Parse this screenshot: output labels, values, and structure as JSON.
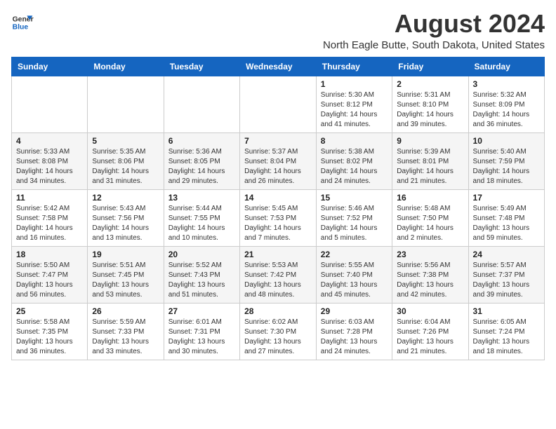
{
  "logo": {
    "line1": "General",
    "line2": "Blue"
  },
  "title": "August 2024",
  "location": "North Eagle Butte, South Dakota, United States",
  "weekdays": [
    "Sunday",
    "Monday",
    "Tuesday",
    "Wednesday",
    "Thursday",
    "Friday",
    "Saturday"
  ],
  "weeks": [
    [
      {
        "day": "",
        "info": ""
      },
      {
        "day": "",
        "info": ""
      },
      {
        "day": "",
        "info": ""
      },
      {
        "day": "",
        "info": ""
      },
      {
        "day": "1",
        "info": "Sunrise: 5:30 AM\nSunset: 8:12 PM\nDaylight: 14 hours\nand 41 minutes."
      },
      {
        "day": "2",
        "info": "Sunrise: 5:31 AM\nSunset: 8:10 PM\nDaylight: 14 hours\nand 39 minutes."
      },
      {
        "day": "3",
        "info": "Sunrise: 5:32 AM\nSunset: 8:09 PM\nDaylight: 14 hours\nand 36 minutes."
      }
    ],
    [
      {
        "day": "4",
        "info": "Sunrise: 5:33 AM\nSunset: 8:08 PM\nDaylight: 14 hours\nand 34 minutes."
      },
      {
        "day": "5",
        "info": "Sunrise: 5:35 AM\nSunset: 8:06 PM\nDaylight: 14 hours\nand 31 minutes."
      },
      {
        "day": "6",
        "info": "Sunrise: 5:36 AM\nSunset: 8:05 PM\nDaylight: 14 hours\nand 29 minutes."
      },
      {
        "day": "7",
        "info": "Sunrise: 5:37 AM\nSunset: 8:04 PM\nDaylight: 14 hours\nand 26 minutes."
      },
      {
        "day": "8",
        "info": "Sunrise: 5:38 AM\nSunset: 8:02 PM\nDaylight: 14 hours\nand 24 minutes."
      },
      {
        "day": "9",
        "info": "Sunrise: 5:39 AM\nSunset: 8:01 PM\nDaylight: 14 hours\nand 21 minutes."
      },
      {
        "day": "10",
        "info": "Sunrise: 5:40 AM\nSunset: 7:59 PM\nDaylight: 14 hours\nand 18 minutes."
      }
    ],
    [
      {
        "day": "11",
        "info": "Sunrise: 5:42 AM\nSunset: 7:58 PM\nDaylight: 14 hours\nand 16 minutes."
      },
      {
        "day": "12",
        "info": "Sunrise: 5:43 AM\nSunset: 7:56 PM\nDaylight: 14 hours\nand 13 minutes."
      },
      {
        "day": "13",
        "info": "Sunrise: 5:44 AM\nSunset: 7:55 PM\nDaylight: 14 hours\nand 10 minutes."
      },
      {
        "day": "14",
        "info": "Sunrise: 5:45 AM\nSunset: 7:53 PM\nDaylight: 14 hours\nand 7 minutes."
      },
      {
        "day": "15",
        "info": "Sunrise: 5:46 AM\nSunset: 7:52 PM\nDaylight: 14 hours\nand 5 minutes."
      },
      {
        "day": "16",
        "info": "Sunrise: 5:48 AM\nSunset: 7:50 PM\nDaylight: 14 hours\nand 2 minutes."
      },
      {
        "day": "17",
        "info": "Sunrise: 5:49 AM\nSunset: 7:48 PM\nDaylight: 13 hours\nand 59 minutes."
      }
    ],
    [
      {
        "day": "18",
        "info": "Sunrise: 5:50 AM\nSunset: 7:47 PM\nDaylight: 13 hours\nand 56 minutes."
      },
      {
        "day": "19",
        "info": "Sunrise: 5:51 AM\nSunset: 7:45 PM\nDaylight: 13 hours\nand 53 minutes."
      },
      {
        "day": "20",
        "info": "Sunrise: 5:52 AM\nSunset: 7:43 PM\nDaylight: 13 hours\nand 51 minutes."
      },
      {
        "day": "21",
        "info": "Sunrise: 5:53 AM\nSunset: 7:42 PM\nDaylight: 13 hours\nand 48 minutes."
      },
      {
        "day": "22",
        "info": "Sunrise: 5:55 AM\nSunset: 7:40 PM\nDaylight: 13 hours\nand 45 minutes."
      },
      {
        "day": "23",
        "info": "Sunrise: 5:56 AM\nSunset: 7:38 PM\nDaylight: 13 hours\nand 42 minutes."
      },
      {
        "day": "24",
        "info": "Sunrise: 5:57 AM\nSunset: 7:37 PM\nDaylight: 13 hours\nand 39 minutes."
      }
    ],
    [
      {
        "day": "25",
        "info": "Sunrise: 5:58 AM\nSunset: 7:35 PM\nDaylight: 13 hours\nand 36 minutes."
      },
      {
        "day": "26",
        "info": "Sunrise: 5:59 AM\nSunset: 7:33 PM\nDaylight: 13 hours\nand 33 minutes."
      },
      {
        "day": "27",
        "info": "Sunrise: 6:01 AM\nSunset: 7:31 PM\nDaylight: 13 hours\nand 30 minutes."
      },
      {
        "day": "28",
        "info": "Sunrise: 6:02 AM\nSunset: 7:30 PM\nDaylight: 13 hours\nand 27 minutes."
      },
      {
        "day": "29",
        "info": "Sunrise: 6:03 AM\nSunset: 7:28 PM\nDaylight: 13 hours\nand 24 minutes."
      },
      {
        "day": "30",
        "info": "Sunrise: 6:04 AM\nSunset: 7:26 PM\nDaylight: 13 hours\nand 21 minutes."
      },
      {
        "day": "31",
        "info": "Sunrise: 6:05 AM\nSunset: 7:24 PM\nDaylight: 13 hours\nand 18 minutes."
      }
    ]
  ]
}
